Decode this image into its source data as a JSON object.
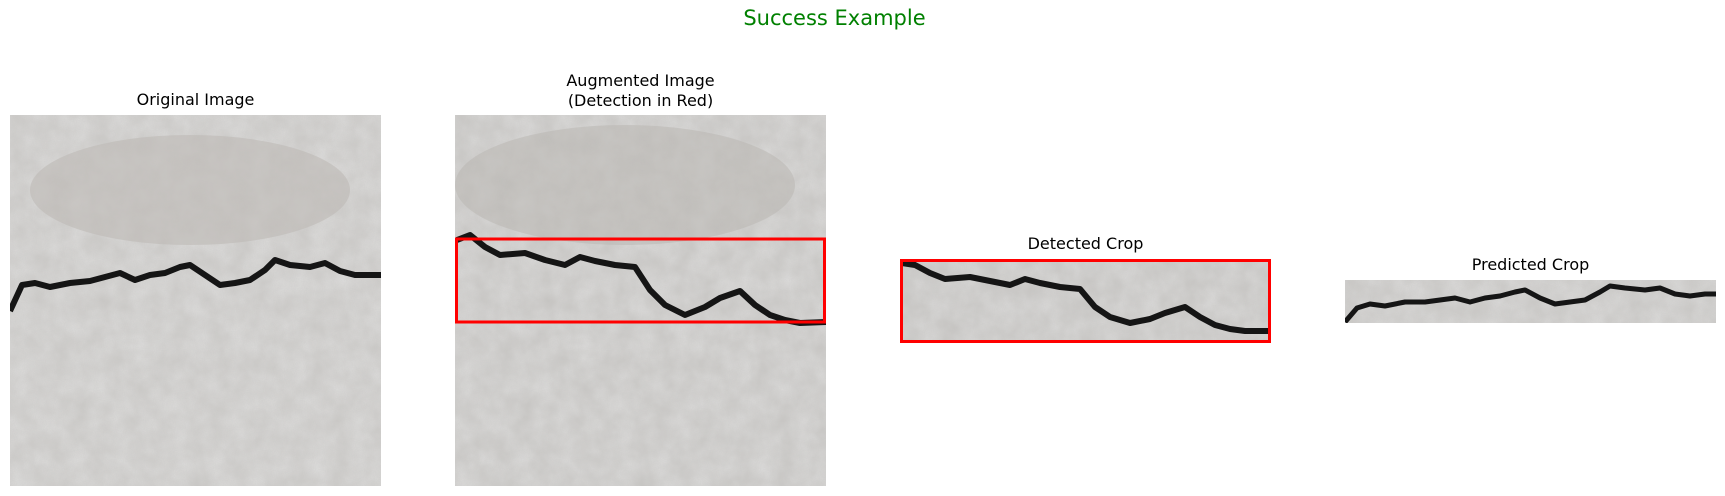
{
  "figure": {
    "suptitle": "Success Example",
    "suptitle_color": "#008000",
    "detection_box_color": "#ff0000"
  },
  "panels": [
    {
      "title": "Original Image",
      "image": "concrete-crack-photo"
    },
    {
      "title": "Augmented Image",
      "title_line2": "(Detection in Red)",
      "image": "concrete-crack-photo-with-detection-box"
    },
    {
      "title": "Detected Crop",
      "image": "crack-crop-with-red-border"
    },
    {
      "title": "Predicted Crop",
      "image": "crack-crop"
    }
  ]
}
